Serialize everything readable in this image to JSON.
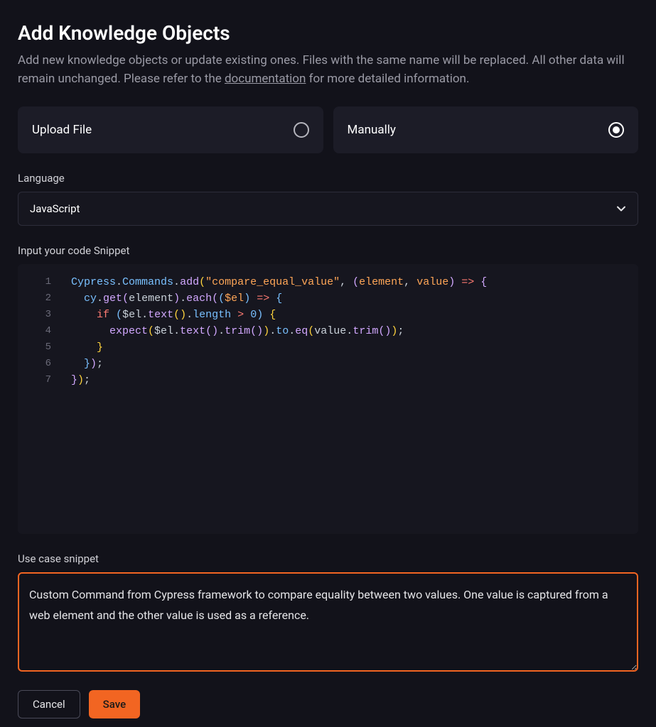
{
  "header": {
    "title": "Add Knowledge Objects",
    "subtitle_before": "Add new knowledge objects or update existing ones. Files with the same name will be replaced. All other data will remain unchanged. Please refer to the ",
    "subtitle_link": "documentation",
    "subtitle_after": " for more detailed information."
  },
  "mode": {
    "upload_label": "Upload File",
    "manual_label": "Manually",
    "selected": "manual"
  },
  "language": {
    "label": "Language",
    "value": "JavaScript"
  },
  "snippet": {
    "label": "Input your code Snippet",
    "lines": {
      "l1": {
        "a": "Cypress",
        "b": ".",
        "c": "Commands",
        "d": ".",
        "e": "add",
        "f": "(",
        "g": "\"compare_equal_value\"",
        "h": ", ",
        "i": "(",
        "j": "element",
        "k": ", ",
        "l": "value",
        "m": ")",
        "n": " ",
        "o": "=>",
        "p": " ",
        "q": "{"
      },
      "l2": {
        "a": "  ",
        "b": "cy",
        "c": ".",
        "d": "get",
        "e": "(",
        "f": "element",
        "g": ")",
        "h": ".",
        "i": "each",
        "j": "(",
        "k": "(",
        "l": "$el",
        "m": ")",
        "n": " ",
        "o": "=>",
        "p": " ",
        "q": "{"
      },
      "l3": {
        "a": "    ",
        "b": "if",
        "c": " ",
        "d": "(",
        "e": "$el",
        "f": ".",
        "g": "text",
        "h": "(",
        "i": ")",
        "j": ".",
        "k": "length",
        "l": " > ",
        "m": "0",
        "n": ")",
        "o": " ",
        "p": "{"
      },
      "l4": {
        "a": "      ",
        "b": "expect",
        "c": "(",
        "d": "$el",
        "e": ".",
        "f": "text",
        "g": "(",
        "h": ")",
        "i": ".",
        "j": "trim",
        "k": "(",
        "l": ")",
        "m": ")",
        "n": ".",
        "o": "to",
        "p": ".",
        "q": "eq",
        "r": "(",
        "s": "value",
        "t": ".",
        "u": "trim",
        "v": "(",
        "w": ")",
        "x": ")",
        "y": ";"
      },
      "l5": {
        "a": "    ",
        "b": "}"
      },
      "l6": {
        "a": "  ",
        "b": "}",
        "c": ")",
        "d": ";"
      },
      "l7": {
        "a": "}",
        "b": ")",
        "c": ";"
      }
    },
    "nums": {
      "n1": "1",
      "n2": "2",
      "n3": "3",
      "n4": "4",
      "n5": "5",
      "n6": "6",
      "n7": "7"
    }
  },
  "usecase": {
    "label": "Use case snippet",
    "value": "Custom Command from Cypress framework to compare equality between two values. One value is captured from a web element and the other value is used as a reference."
  },
  "buttons": {
    "cancel": "Cancel",
    "save": "Save"
  }
}
